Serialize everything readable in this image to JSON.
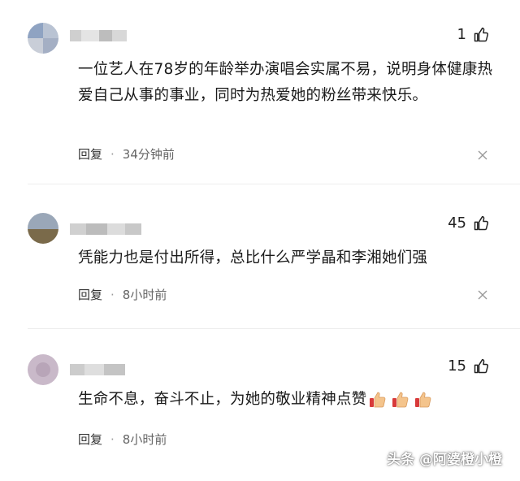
{
  "comments": [
    {
      "likes": "1",
      "text": "一位艺人在78岁的年龄举办演唱会实属不易，说明身体健康热爱自己从事的事业，同时为热爱她的粉丝带来快乐。",
      "reply_label": "回复",
      "separator": "·",
      "time": "34分钟前"
    },
    {
      "likes": "45",
      "text": "凭能力也是付出所得，总比什么严学晶和李湘她们强",
      "reply_label": "回复",
      "separator": "·",
      "time": "8小时前"
    },
    {
      "likes": "15",
      "text": "生命不息，奋斗不止，为她的敬业精神点赞",
      "reply_label": "回复",
      "separator": "·",
      "time": "8小时前"
    }
  ],
  "icons": {
    "like": "thumbs-up-icon",
    "close": "close-icon",
    "emoji": "thumbs-up-emoji"
  },
  "colors": {
    "text": "#1a1a1a",
    "meta": "#666666",
    "divider": "#ededed"
  },
  "watermark": "头条 @阿婆橙小橙"
}
